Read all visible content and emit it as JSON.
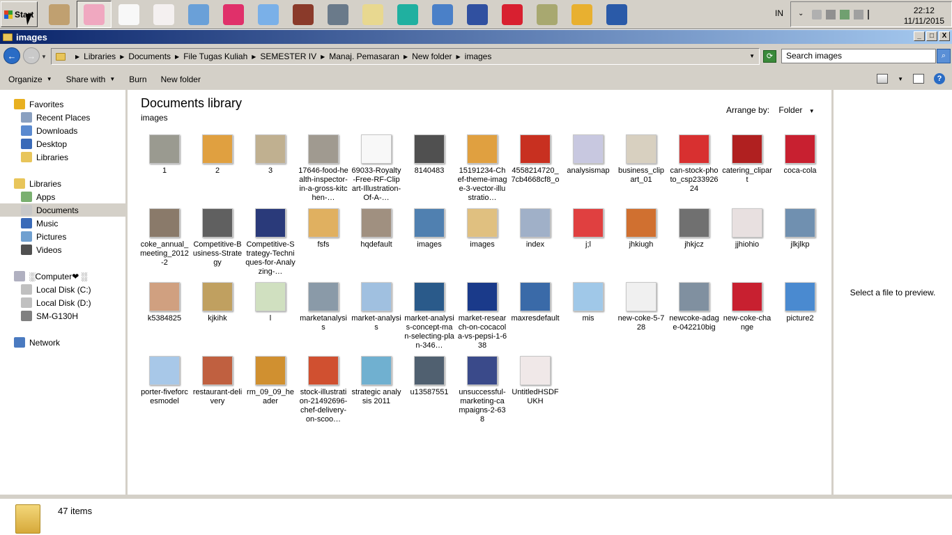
{
  "taskbar": {
    "start_label": "Start",
    "quick_launch": [
      {
        "icon": "hamster-icon",
        "color": "#c0a070"
      },
      {
        "icon": "folder-pink-icon",
        "color": "#f0a8c0"
      },
      {
        "icon": "hello-kitty-icon",
        "color": "#f8f8f8"
      },
      {
        "icon": "hello-kitty-bow-icon",
        "color": "#f4f0f0"
      },
      {
        "icon": "control-panel-icon",
        "color": "#6aa0d8"
      },
      {
        "icon": "flower-icon",
        "color": "#e0306a"
      },
      {
        "icon": "flower-blue-icon",
        "color": "#7ab0e8"
      },
      {
        "icon": "book-icon",
        "color": "#8a3a2a"
      },
      {
        "icon": "headphones-icon",
        "color": "#6a7a8a"
      },
      {
        "icon": "sticky-notes-icon",
        "color": "#e8d890"
      },
      {
        "icon": "jpg-viewer-icon",
        "color": "#20b0a0"
      },
      {
        "icon": "usb-drive-icon",
        "color": "#4a80c8"
      },
      {
        "icon": "tv-robot-icon",
        "color": "#3050a0"
      },
      {
        "icon": "oo-player-icon",
        "color": "#d82030"
      },
      {
        "icon": "search-tool-icon",
        "color": "#a8a870"
      },
      {
        "icon": "paint-palette-icon",
        "color": "#e8b030"
      },
      {
        "icon": "word-icon",
        "color": "#2a5aa8"
      }
    ],
    "language": "IN",
    "time": "22:12",
    "date": "11/11/2015"
  },
  "window": {
    "title": "images",
    "minimize": "_",
    "maximize": "□",
    "close": "X"
  },
  "address": {
    "breadcrumbs": [
      "Libraries",
      "Documents",
      "File Tugas Kuliah",
      "SEMESTER IV",
      "Manaj. Pemasaran",
      "New folder",
      "images"
    ],
    "search_placeholder": "Search images"
  },
  "toolbar": {
    "organize": "Organize",
    "share_with": "Share with",
    "burn": "Burn",
    "new_folder": "New folder"
  },
  "nav": {
    "items": [
      {
        "label": "Favorites",
        "icon": "star-icon",
        "color": "#e8b020"
      },
      {
        "label": "Recent Places",
        "icon": "recent-places-icon",
        "color": "#8aa0c0"
      },
      {
        "label": "Downloads",
        "icon": "downloads-icon",
        "color": "#5a8ad0"
      },
      {
        "label": "Desktop",
        "icon": "desktop-icon",
        "color": "#3a6ab8"
      },
      {
        "label": "Libraries",
        "icon": "libraries-icon",
        "color": "#e8c55a"
      },
      {
        "label": "Libraries",
        "icon": "libraries-icon",
        "color": "#e8c55a"
      },
      {
        "label": "Apps",
        "icon": "apps-icon",
        "color": "#7ab070"
      },
      {
        "label": "Documents",
        "icon": "documents-icon",
        "color": "#c8c8c8"
      },
      {
        "label": "Music",
        "icon": "music-icon",
        "color": "#3a6ab8"
      },
      {
        "label": "Pictures",
        "icon": "pictures-icon",
        "color": "#70a0d0"
      },
      {
        "label": "Videos",
        "icon": "videos-icon",
        "color": "#505050"
      },
      {
        "label": "░Computer❤ ░",
        "icon": "computer-icon",
        "color": "#b0b0c0"
      },
      {
        "label": "Local Disk (C:)",
        "icon": "disk-icon",
        "color": "#c0c0c0"
      },
      {
        "label": "Local Disk (D:)",
        "icon": "disk-icon",
        "color": "#c0c0c0"
      },
      {
        "label": "SM-G130H",
        "icon": "phone-icon",
        "color": "#808080"
      },
      {
        "label": "Network",
        "icon": "network-icon",
        "color": "#4a7ac0"
      }
    ]
  },
  "content": {
    "title": "Documents library",
    "subtitle": "images",
    "arrange_label": "Arrange by:",
    "arrange_value": "Folder",
    "files": [
      {
        "name": "1",
        "color": "#9a9a90"
      },
      {
        "name": "2",
        "color": "#e0a040"
      },
      {
        "name": "3",
        "color": "#c0b090"
      },
      {
        "name": "17646-food-health-inspector-in-a-gross-kitchen-…",
        "color": "#a09a90"
      },
      {
        "name": "69033-Royalty-Free-RF-Clipart-Illustration-Of-A-…",
        "color": "#f8f8f8"
      },
      {
        "name": "8140483",
        "color": "#505050"
      },
      {
        "name": "15191234-Chef-theme-image-3-vector-illustratio…",
        "color": "#e0a040"
      },
      {
        "name": "4558214720_7cb4668cf8_o",
        "color": "#c83020"
      },
      {
        "name": "analysismap",
        "color": "#c8c8e0"
      },
      {
        "name": "business_clipart_01",
        "color": "#d8d0c0"
      },
      {
        "name": "can-stock-photo_csp23392624",
        "color": "#d83030"
      },
      {
        "name": "catering_clipart",
        "color": "#b02020"
      },
      {
        "name": "coca-cola",
        "color": "#c82030"
      },
      {
        "name": "coke_annual_meeting_2012-2",
        "color": "#8a7a6a"
      },
      {
        "name": "Competitive-Business-Strategy",
        "color": "#606060"
      },
      {
        "name": "Competitive-Strategy-Techniques-for-Analyzing-…",
        "color": "#2a3a7a"
      },
      {
        "name": "fsfs",
        "color": "#e0b060"
      },
      {
        "name": "hqdefault",
        "color": "#a09080"
      },
      {
        "name": "images",
        "color": "#5080b0"
      },
      {
        "name": "images",
        "color": "#e0c080"
      },
      {
        "name": "index",
        "color": "#a0b0c8"
      },
      {
        "name": "j;l",
        "color": "#e04040"
      },
      {
        "name": "jhkiugh",
        "color": "#d07030"
      },
      {
        "name": "jhkjcz",
        "color": "#707070"
      },
      {
        "name": "jjhiohio",
        "color": "#e8e0e0"
      },
      {
        "name": "jlkjlkp",
        "color": "#7090b0"
      },
      {
        "name": "k5384825",
        "color": "#d0a080"
      },
      {
        "name": "kjkihk",
        "color": "#c0a060"
      },
      {
        "name": "l",
        "color": "#d0e0c0"
      },
      {
        "name": "marketanalysis",
        "color": "#8a9aa8"
      },
      {
        "name": "market-analysis",
        "color": "#a0c0e0"
      },
      {
        "name": "market-analysis-concept-man-selecting-plan-346…",
        "color": "#2a5a8a"
      },
      {
        "name": "market-research-on-cocacola-vs-pepsi-1-638",
        "color": "#1a3a8a"
      },
      {
        "name": "maxresdefault",
        "color": "#3a6aa8"
      },
      {
        "name": "mis",
        "color": "#a0c8e8"
      },
      {
        "name": "new-coke-5-728",
        "color": "#f0f0f0"
      },
      {
        "name": "newcoke-adage-042210big",
        "color": "#8090a0"
      },
      {
        "name": "new-coke-change",
        "color": "#c82030"
      },
      {
        "name": "picture2",
        "color": "#4a8ad0"
      },
      {
        "name": "porter-fiveforcesmodel",
        "color": "#a8c8e8"
      },
      {
        "name": "restaurant-delivery",
        "color": "#c06040"
      },
      {
        "name": "rm_09_09_header",
        "color": "#d09030"
      },
      {
        "name": "stock-illustration-21492696-chef-delivery-on-scoo…",
        "color": "#d05030"
      },
      {
        "name": "strategic analysis 2011",
        "color": "#70b0d0"
      },
      {
        "name": "u13587551",
        "color": "#506070"
      },
      {
        "name": "unsuccessful-marketing-campaigns-2-638",
        "color": "#3a4a8a"
      },
      {
        "name": "UntitledHSDFUKH",
        "color": "#f0e8e8"
      }
    ]
  },
  "preview": {
    "text": "Select a file to preview."
  },
  "status": {
    "count": "47 items"
  }
}
